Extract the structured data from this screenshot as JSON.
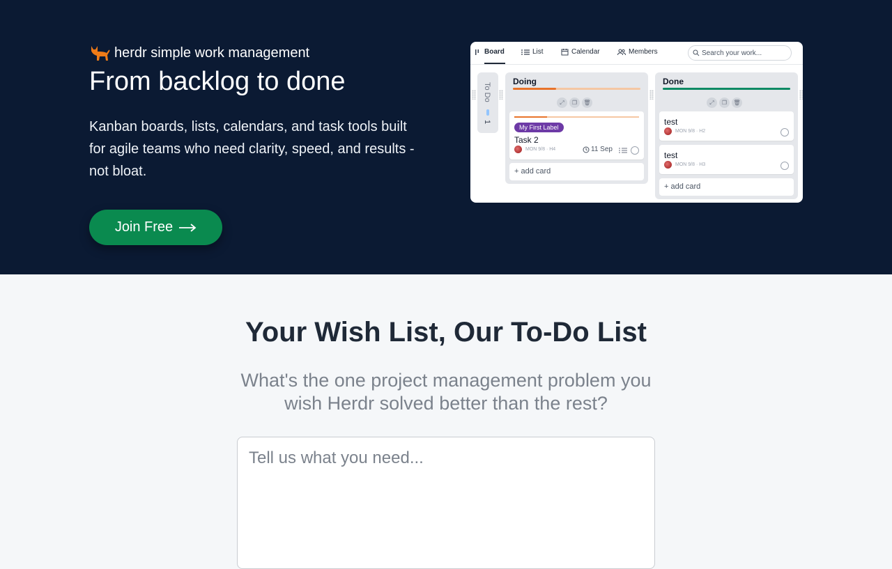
{
  "hero": {
    "brand": "herdr simple work management",
    "headline": "From backlog to done",
    "description": "Kanban boards, lists, calendars, and task tools built for agile teams who need clarity, speed, and results - not bloat.",
    "cta_label": "Join Free",
    "colors": {
      "background": "#0b1a33",
      "cta": "#0a8a4f",
      "cat": "#f07b17"
    }
  },
  "preview": {
    "tabs": [
      "Board",
      "List",
      "Calendar",
      "Members"
    ],
    "active_tab": "Board",
    "search_placeholder": "Search your work...",
    "todo": {
      "title": "To Do",
      "count": "1"
    },
    "columns": [
      {
        "title": "Doing",
        "progress": 0.34,
        "bar_color": "#e8732a",
        "cards": [
          {
            "label": "My First Label",
            "title": "Task 2",
            "meta": "MON 9/8 · H4",
            "due": "11 Sep"
          }
        ],
        "add_label": "+ add card"
      },
      {
        "title": "Done",
        "progress": 1.0,
        "bar_color": "#0e8a64",
        "cards": [
          {
            "title": "test",
            "meta": "MON 9/8 · H2"
          },
          {
            "title": "test",
            "meta": "MON 9/8 · H3"
          }
        ],
        "add_label": "+ add card"
      }
    ]
  },
  "wish": {
    "title": "Your Wish List, Our To-Do List",
    "subtitle": "What's the one project management problem you wish Herdr solved better than the rest?",
    "placeholder": "Tell us what you need..."
  }
}
